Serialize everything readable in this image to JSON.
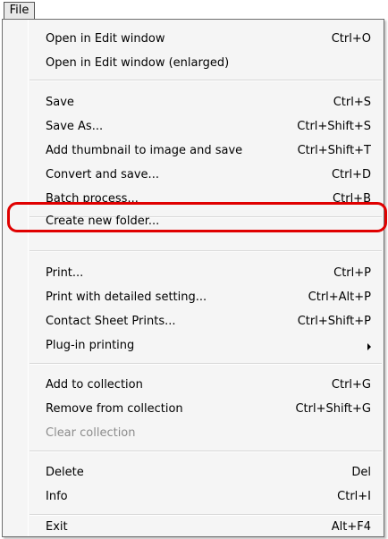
{
  "menubar": {
    "file_label": "File"
  },
  "menu": {
    "items": [
      {
        "label": "Open in Edit window",
        "accel": "Ctrl+O"
      },
      {
        "label": "Open in Edit window (enlarged)",
        "accel": ""
      },
      {
        "label": "Save",
        "accel": "Ctrl+S"
      },
      {
        "label": "Save As...",
        "accel": "Ctrl+Shift+S"
      },
      {
        "label": "Add thumbnail to image and save",
        "accel": "Ctrl+Shift+T"
      },
      {
        "label": "Convert and save...",
        "accel": "Ctrl+D"
      },
      {
        "label": "Batch process...",
        "accel": "Ctrl+B"
      },
      {
        "label": "Create new folder...",
        "accel": ""
      },
      {
        "label": "Print...",
        "accel": "Ctrl+P"
      },
      {
        "label": "Print with detailed setting...",
        "accel": "Ctrl+Alt+P"
      },
      {
        "label": "Contact Sheet Prints...",
        "accel": "Ctrl+Shift+P"
      },
      {
        "label": "Plug-in printing",
        "accel": ""
      },
      {
        "label": "Add to collection",
        "accel": "Ctrl+G"
      },
      {
        "label": "Remove from collection",
        "accel": "Ctrl+Shift+G"
      },
      {
        "label": "Clear collection",
        "accel": ""
      },
      {
        "label": "Delete",
        "accel": "Del"
      },
      {
        "label": "Info",
        "accel": "Ctrl+I"
      },
      {
        "label": "Exit",
        "accel": "Alt+F4"
      }
    ]
  },
  "highlight_color": "#e00000"
}
